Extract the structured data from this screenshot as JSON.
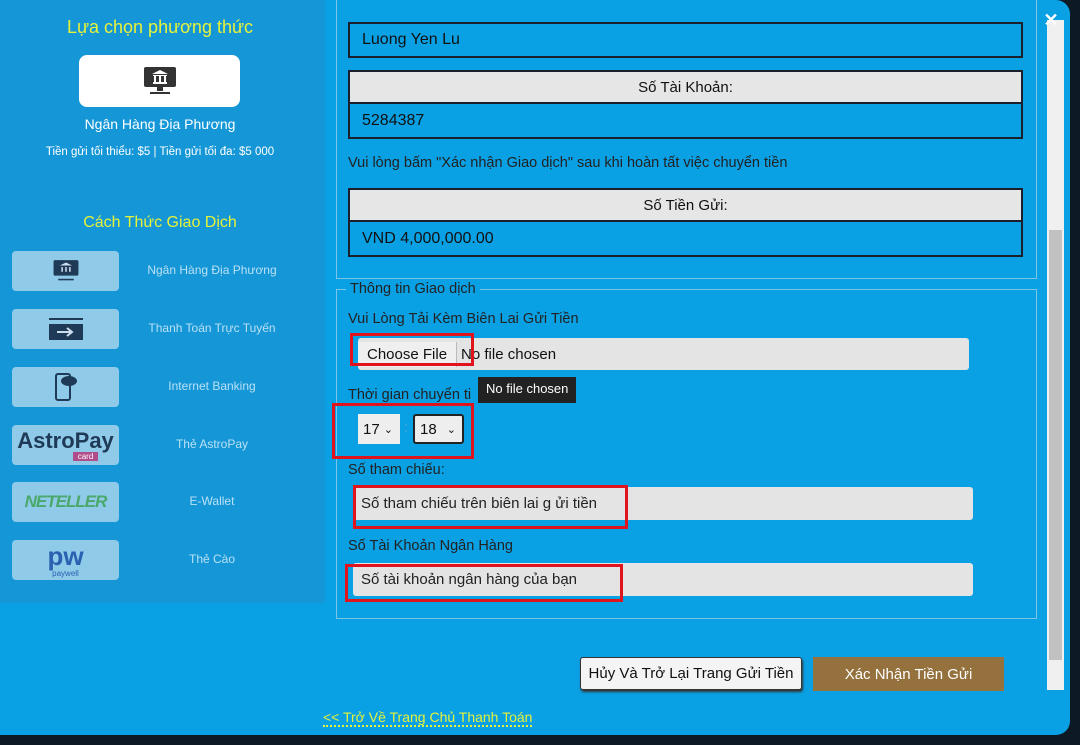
{
  "sidebar": {
    "title": "Lựa chọn phương thức",
    "selected": {
      "icon": "bank-monitor-icon",
      "name": "Ngân Hàng Địa Phương",
      "limits": "Tiền gửi tối thiểu: $5 | Tiền gửi tối đa: $5 000"
    },
    "methods_title": "Cách Thức Giao Dịch",
    "methods": [
      {
        "icon": "bank-monitor-icon",
        "label": "Ngân Hàng Địa Phương"
      },
      {
        "icon": "card-transfer-icon",
        "label": "Thanh Toán Trực Tuyến"
      },
      {
        "icon": "mobile-banking-icon",
        "label": "Internet Banking"
      },
      {
        "icon": "astropay-logo",
        "logo_text": "AstroPay",
        "logo_sub": "card",
        "label": "Thẻ AstroPay"
      },
      {
        "icon": "neteller-logo",
        "logo_text": "NETELLER",
        "label": "E-Wallet"
      },
      {
        "icon": "paywell-logo",
        "logo_text": "pw",
        "logo_sub": "paywell",
        "label": "Thẻ Cào"
      }
    ]
  },
  "bank_info": {
    "account_name": "Luong Yen Lu",
    "account_number_label": "Số Tài Khoản:",
    "account_number": "5284387",
    "note": "Vui lòng bấm \"Xác nhận Giao dịch\" sau khi hoàn tất việc chuyển tiền",
    "amount_label": "Số Tiền Gửi:",
    "amount": "VND 4,000,000.00"
  },
  "transaction": {
    "legend": "Thông tin Giao dịch",
    "receipt_label": "Vui Lòng Tải Kèm Biên Lai Gửi Tiền",
    "choose_file": "Choose File",
    "no_file": "No file chosen",
    "tooltip": "No file chosen",
    "time_label": "Thời gian chuyển ti",
    "hour": "17",
    "minute": "18",
    "separator": ":",
    "ref_label": "Số tham chiếu:",
    "ref_placeholder": "Số tham chiếu trên biên lai g ửi tiền",
    "acct_label": "Số Tài Khoản Ngân Hàng",
    "acct_placeholder": "Số tài khoản ngân hàng của bạn"
  },
  "buttons": {
    "cancel": "Hủy Và Trở Lại Trang Gửi Tiền",
    "confirm": "Xác Nhận Tiền Gửi"
  },
  "back_link": "<< Trở Về Trang Chủ Thanh Toán",
  "close": "✕",
  "colors": {
    "background": "#0aa0e4",
    "sidebar": "#1597d7",
    "title_yellow": "#e5f23a",
    "confirm_button": "#94713d",
    "highlight": "#e0141c"
  }
}
